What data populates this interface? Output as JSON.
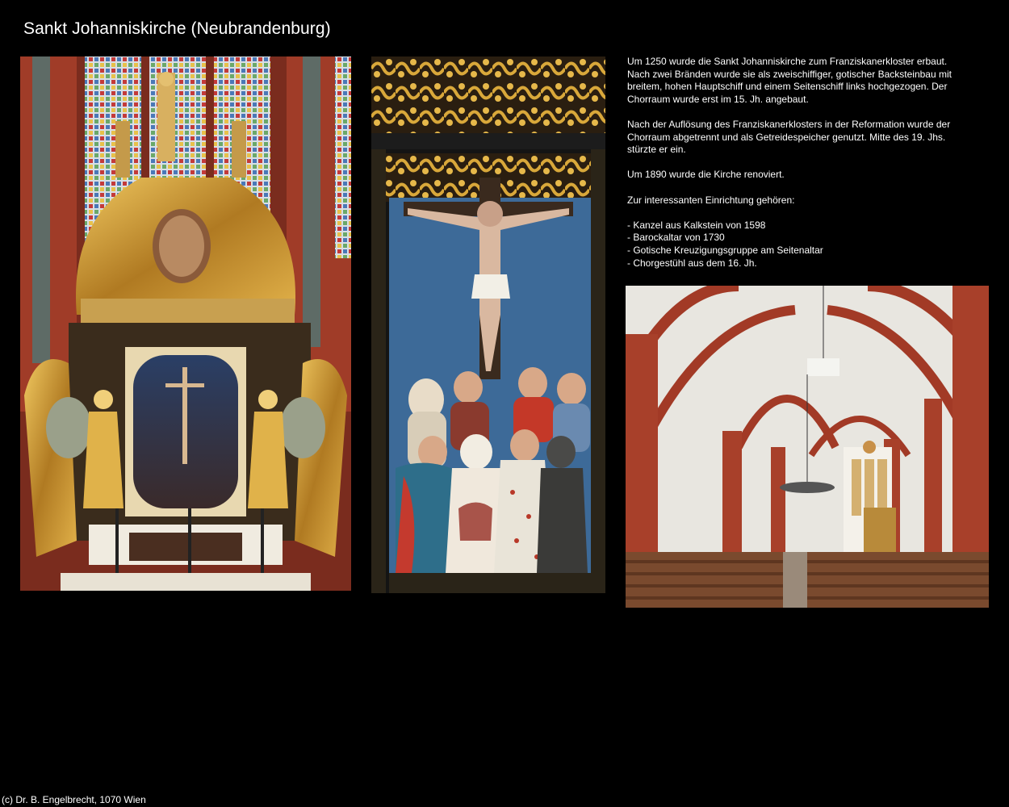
{
  "header": {
    "title": "Sankt Johanniskirche (Neubrandenburg)"
  },
  "description": {
    "paragraph_1": "Um 1250 wurde die Sankt Johanniskirche zum Franziskanerkloster erbaut. Nach zwei Bränden wurde sie als zweischiffiger, gotischer Backsteinbau mit breitem, hohen Hauptschiff und einem Seitenschiff links hochgezogen. Der Chorraum wurde erst im 15. Jh. angebaut.",
    "paragraph_2": "Nach der Auflösung des Franziskanerklosters in der Reformation wurde der Chorraum abgetrennt und als Getreidespeicher genutzt. Mitte des 19. Jhs. stürzte er ein.",
    "paragraph_3": "Um 1890 wurde die Kirche renoviert.",
    "features_intro": "Zur interessanten Einrichtung gehören:",
    "features": [
      "- Kanzel aus Kalkstein von 1598",
      "- Barockaltar von 1730",
      "- Gotische Kreuzigungsgruppe am Seitenaltar",
      "- Chorgestühl aus dem 16. Jh."
    ]
  },
  "footer": {
    "credit": "(c) Dr. B. Engelbrecht, 1070 Wien"
  },
  "colors": {
    "background": "#000000",
    "text": "#ffffff",
    "brick": "#9c3a26",
    "gold": "#c9962e",
    "wall": "#efece6"
  }
}
